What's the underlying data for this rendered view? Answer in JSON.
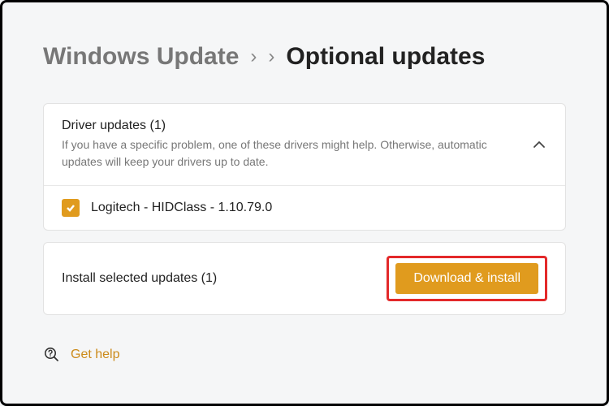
{
  "breadcrumb": {
    "parent": "Windows Update",
    "current": "Optional updates"
  },
  "expander": {
    "title": "Driver updates (1)",
    "description": "If you have a specific problem, one of these drivers might help. Otherwise, automatic updates will keep your drivers up to date."
  },
  "updates": {
    "items": [
      {
        "label": "Logitech - HIDClass - 1.10.79.0",
        "checked": true
      }
    ]
  },
  "installBar": {
    "label": "Install selected updates (1)",
    "button": "Download & install"
  },
  "help": {
    "label": "Get help"
  }
}
